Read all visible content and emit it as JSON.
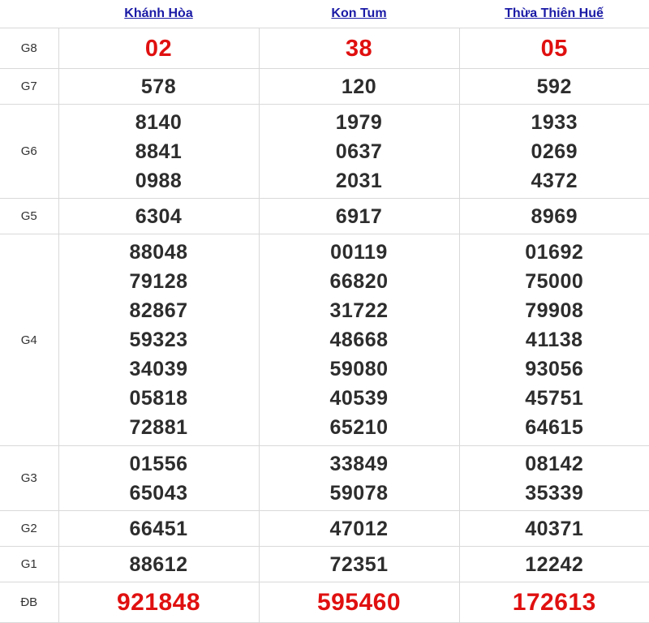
{
  "provinces": [
    "Khánh Hòa",
    "Kon Tum",
    "Thừa Thiên Huế"
  ],
  "prizes": [
    {
      "label": "G8",
      "key": "g8",
      "highlight": true,
      "values": [
        [
          "02"
        ],
        [
          "38"
        ],
        [
          "05"
        ]
      ]
    },
    {
      "label": "G7",
      "key": "g7",
      "highlight": false,
      "values": [
        [
          "578"
        ],
        [
          "120"
        ],
        [
          "592"
        ]
      ]
    },
    {
      "label": "G6",
      "key": "g6",
      "highlight": false,
      "values": [
        [
          "8140",
          "8841",
          "0988"
        ],
        [
          "1979",
          "0637",
          "2031"
        ],
        [
          "1933",
          "0269",
          "4372"
        ]
      ]
    },
    {
      "label": "G5",
      "key": "g5",
      "highlight": false,
      "values": [
        [
          "6304"
        ],
        [
          "6917"
        ],
        [
          "8969"
        ]
      ]
    },
    {
      "label": "G4",
      "key": "g4",
      "highlight": false,
      "values": [
        [
          "88048",
          "79128",
          "82867",
          "59323",
          "34039",
          "05818",
          "72881"
        ],
        [
          "00119",
          "66820",
          "31722",
          "48668",
          "59080",
          "40539",
          "65210"
        ],
        [
          "01692",
          "75000",
          "79908",
          "41138",
          "93056",
          "45751",
          "64615"
        ]
      ]
    },
    {
      "label": "G3",
      "key": "g3",
      "highlight": false,
      "values": [
        [
          "01556",
          "65043"
        ],
        [
          "33849",
          "59078"
        ],
        [
          "08142",
          "35339"
        ]
      ]
    },
    {
      "label": "G2",
      "key": "g2",
      "highlight": false,
      "values": [
        [
          "66451"
        ],
        [
          "47012"
        ],
        [
          "40371"
        ]
      ]
    },
    {
      "label": "G1",
      "key": "g1",
      "highlight": false,
      "values": [
        [
          "88612"
        ],
        [
          "72351"
        ],
        [
          "12242"
        ]
      ]
    },
    {
      "label": "ĐB",
      "key": "db",
      "highlight": true,
      "values": [
        [
          "921848"
        ],
        [
          "595460"
        ],
        [
          "172613"
        ]
      ]
    }
  ],
  "colors": {
    "highlight": "#e01010",
    "link": "#1a1aa6",
    "text": "#2d2d2d",
    "border": "#d9d9d9"
  }
}
